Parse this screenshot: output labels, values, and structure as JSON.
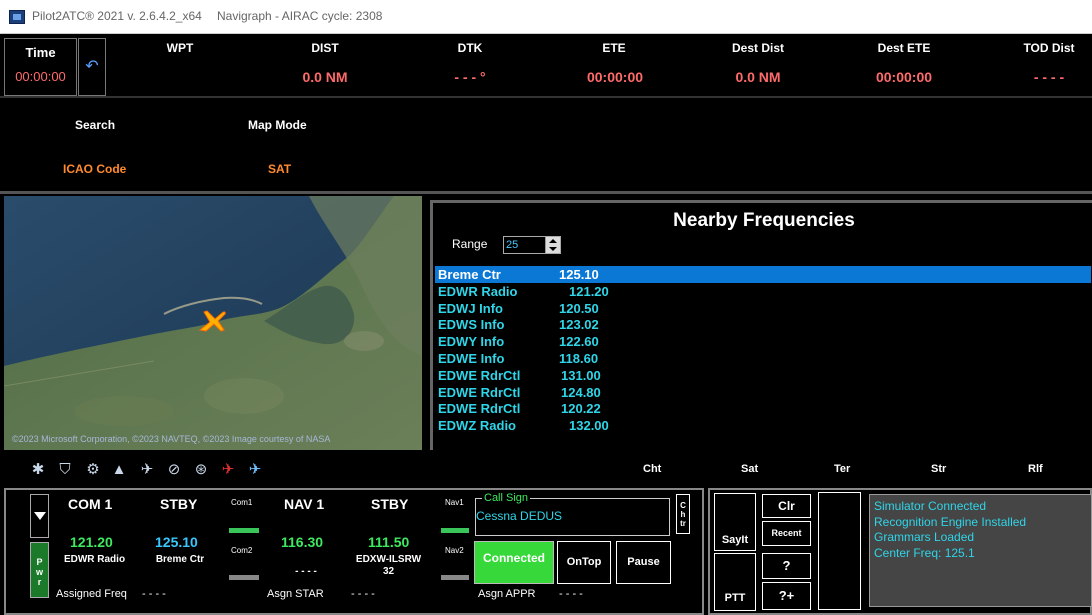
{
  "window": {
    "app_title": "Pilot2ATC® 2021 v. 2.6.4.2_x64",
    "navdata": "Navigraph - AIRAC cycle: 2308"
  },
  "topbar": {
    "time_label": "Time",
    "time_value": "00:00:00",
    "wpt_label": "WPT",
    "wpt_value": "",
    "dist_label": "DIST",
    "dist_value": "0.0 NM",
    "dtk_label": "DTK",
    "dtk_value": "- - - °",
    "ete_label": "ETE",
    "ete_value": "00:00:00",
    "destdist_label": "Dest Dist",
    "destdist_value": "0.0 NM",
    "destete_label": "Dest ETE",
    "destete_value": "00:00:00",
    "toddist_label": "TOD Dist",
    "toddist_value": "- - - -"
  },
  "toolbar": {
    "search_label": "Search",
    "search_value": "ICAO Code",
    "mapmode_label": "Map Mode",
    "mapmode_value": "SAT"
  },
  "map": {
    "copyright": "©2023 Microsoft Corporation, ©2023 NAVTEQ, ©2023 Image courtesy of NASA"
  },
  "frequencies": {
    "title": "Nearby Frequencies",
    "range_label": "Range",
    "range_value": "25",
    "rows": [
      {
        "name": "Breme Ctr",
        "freq": "125.10",
        "selected": true
      },
      {
        "name": "EDWR Radio",
        "freq": "121.20",
        "selected": false
      },
      {
        "name": "EDWJ Info",
        "freq": "120.50",
        "selected": false
      },
      {
        "name": "EDWS Info",
        "freq": "123.02",
        "selected": false
      },
      {
        "name": "EDWY Info",
        "freq": "122.60",
        "selected": false
      },
      {
        "name": "EDWE Info",
        "freq": "118.60",
        "selected": false
      },
      {
        "name": "EDWE RdrCtl",
        "freq": "131.00",
        "selected": false
      },
      {
        "name": "EDWE RdrCtl",
        "freq": "124.80",
        "selected": false
      },
      {
        "name": "EDWE RdrCtl",
        "freq": "120.22",
        "selected": false
      },
      {
        "name": "EDWZ Radio",
        "freq": "132.00",
        "selected": false
      }
    ]
  },
  "tabs": {
    "cht": "Cht",
    "sat": "Sat",
    "ter": "Ter",
    "str": "Str",
    "rlf": "Rlf"
  },
  "radio": {
    "pwr_label": "P\nw\nr",
    "com1_label": "COM 1",
    "com1_freq": "121.20",
    "com1_station": "EDWR Radio",
    "com1_stby_label": "STBY",
    "com1_stby_freq": "125.10",
    "com1_stby_station": "Breme Ctr",
    "com1_tiny": "Com1",
    "com2_tiny": "Com2",
    "nav1_label": "NAV 1",
    "nav1_freq": "116.30",
    "nav1_station": "- - - -",
    "nav1_stby_label": "STBY",
    "nav1_stby_freq": "111.50",
    "nav1_stby_station": "EDXW-ILSRW 32",
    "nav1_tiny": "Nav1",
    "nav2_tiny": "Nav2",
    "assigned_freq_label": "Assigned Freq",
    "assigned_freq_value": "- - - -",
    "asgn_star_label": "Asgn STAR",
    "asgn_star_value": "- - - -",
    "asgn_appr_label": "Asgn APPR",
    "asgn_appr_value": "- - - -",
    "callsign_label": "Call Sign",
    "callsign_value": "Cessna DEDUS",
    "chtr_label": "C\nh\ntr",
    "connected_label": "Connected",
    "ontop_label": "OnTop",
    "pause_label": "Pause"
  },
  "controls": {
    "sayit_label": "SayIt",
    "clr_label": "Clr",
    "recent_label": "Recent",
    "ptt_label": "PTT",
    "question_label": "?",
    "questionplus_label": "?+"
  },
  "status": {
    "lines": [
      "Simulator Connected",
      "Recognition Engine Installed",
      "Grammars Loaded",
      "Center Freq: 125.1"
    ]
  }
}
